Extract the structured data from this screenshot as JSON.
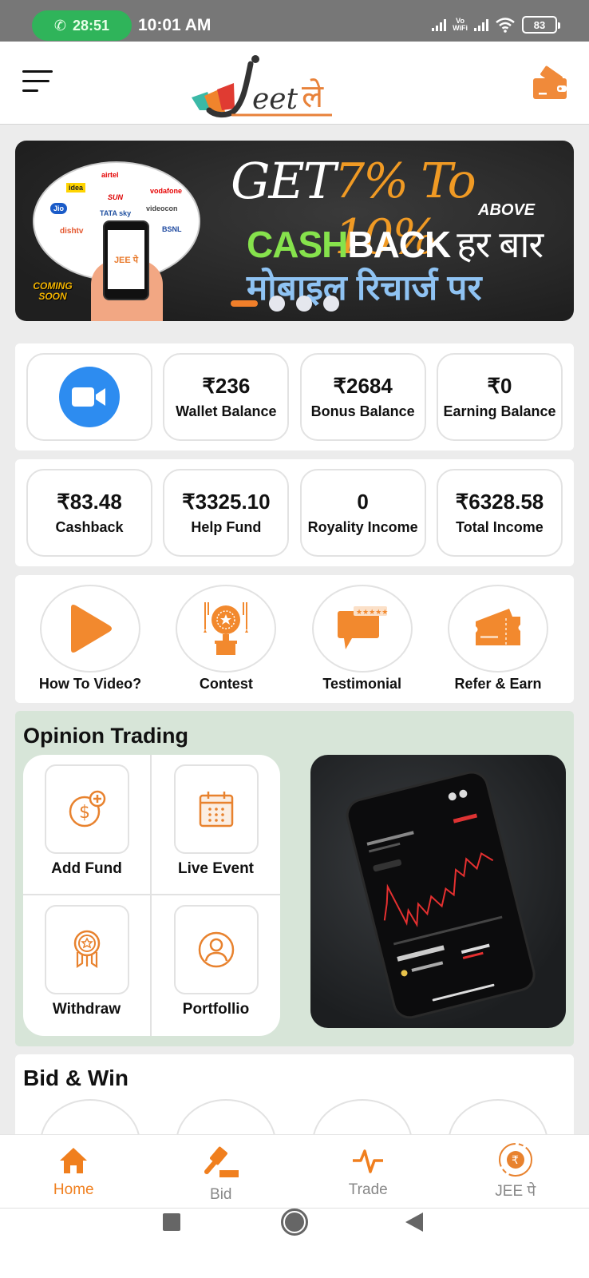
{
  "status_bar": {
    "call_timer": "28:51",
    "time": "10:01 AM",
    "vowifi_label_top": "Vo",
    "vowifi_label_bottom": "WiFi",
    "battery": "83"
  },
  "header": {
    "logo_text": "Jeet ले",
    "menu_icon": "hamburger-icon",
    "wallet_icon": "wallet-icon"
  },
  "banner": {
    "line1_get": "GET",
    "line1_percent": "7% To 10%",
    "line1_above": "ABOVE",
    "line2_cash": "CASH",
    "line2_back": "BACK",
    "line2_hindi": "हर बार",
    "line3_hindi": "मोबाइल रिचार्ज पर",
    "badge": "COMING SOON",
    "phone_brand": "JEE पे",
    "brands": [
      "airtel",
      "idea",
      "vodafone",
      "SUN",
      "Jio",
      "TATA sky",
      "videocon",
      "dishtv",
      "BSNL"
    ],
    "slides_total": 4,
    "active_slide": 1,
    "accent": "#f07f2a"
  },
  "balances": [
    {
      "type": "video-call",
      "icon": "video-camera-icon"
    },
    {
      "value": "₹236",
      "label": "Wallet Balance"
    },
    {
      "value": "₹2684",
      "label": "Bonus Balance"
    },
    {
      "value": "₹0",
      "label": "Earning Balance"
    }
  ],
  "incomes": [
    {
      "value": "₹83.48",
      "label": "Cashback"
    },
    {
      "value": "₹3325.10",
      "label": "Help Fund"
    },
    {
      "value": "0",
      "label": "Royality Income"
    },
    {
      "value": "₹6328.58",
      "label": "Total Income"
    }
  ],
  "actions": [
    {
      "label": "How To Video?",
      "icon": "play-icon"
    },
    {
      "label": "Contest",
      "icon": "trophy-icon"
    },
    {
      "label": "Testimonial",
      "icon": "review-chat-icon"
    },
    {
      "label": "Refer & Earn",
      "icon": "ticket-icon"
    }
  ],
  "opinion_trading": {
    "title": "Opinion Trading",
    "items": [
      {
        "label": "Add Fund",
        "icon": "add-money-icon"
      },
      {
        "label": "Live Event",
        "icon": "calendar-icon"
      },
      {
        "label": "Withdraw",
        "icon": "medal-icon"
      },
      {
        "label": "Portfollio",
        "icon": "user-circle-icon"
      }
    ],
    "image_alt": "trading-app-phone-image"
  },
  "bid_win": {
    "title": "Bid & Win",
    "items": [
      {
        "icon": "coin-icon"
      },
      {
        "icon": "gavel-icon"
      },
      {
        "icon": "cross-icon"
      },
      {
        "icon": "trophy-cup-icon"
      }
    ]
  },
  "bottom_nav": [
    {
      "label": "Home",
      "icon": "home-icon",
      "active": true
    },
    {
      "label": "Bid",
      "icon": "gavel-icon",
      "active": false
    },
    {
      "label": "Trade",
      "icon": "pulse-icon",
      "active": false
    },
    {
      "label": "JEE पे",
      "icon": "rupee-circle-icon",
      "active": false
    }
  ],
  "colors": {
    "brand_orange": "#f07f1e",
    "zoom_blue": "#2d8cf0",
    "opinion_bg": "#d7e5d8",
    "call_green": "#2fb45a"
  }
}
